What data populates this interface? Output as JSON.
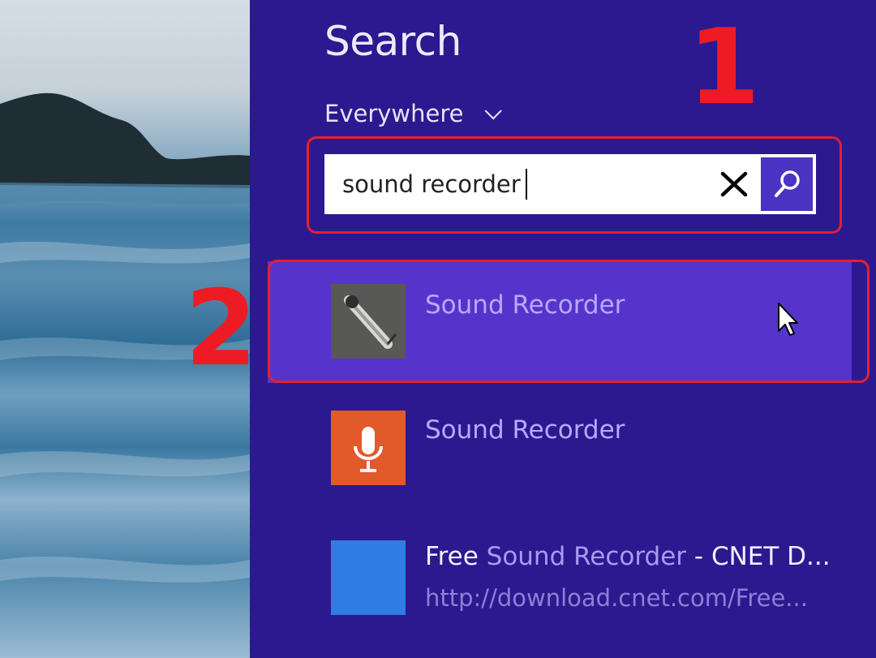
{
  "panel": {
    "title": "Search",
    "scope_label": "Everywhere",
    "search_value": "sound recorder",
    "annotations": {
      "first": "1",
      "second": "2"
    }
  },
  "results": [
    {
      "title": "Sound Recorder",
      "icon": "microphone-desktop-icon"
    },
    {
      "title": "Sound Recorder",
      "icon": "microphone-app-icon"
    },
    {
      "title_prefix": "Free ",
      "title_highlight": "Sound Recorder",
      "title_suffix": " - CNET D...",
      "url": "http://download.cnet.com/Free..."
    }
  ],
  "colors": {
    "panel_bg": "#2c1990",
    "selected_bg": "#5634cc",
    "annotation": "#ee1b24",
    "app_tile": "#e2592a",
    "web_tile": "#2f7de3"
  }
}
